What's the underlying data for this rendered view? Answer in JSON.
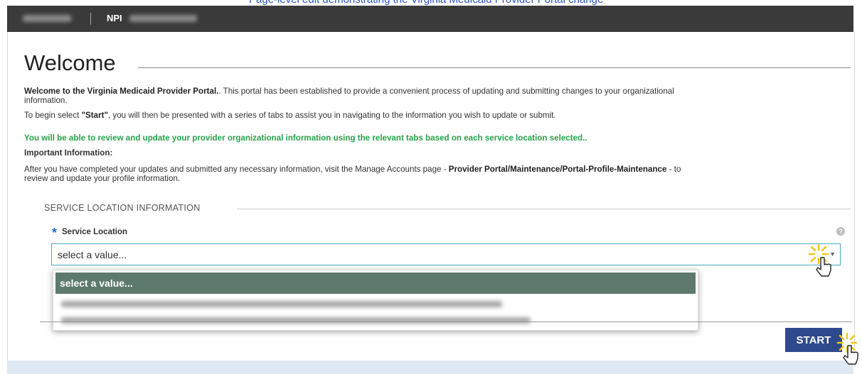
{
  "caption": "Page-level edit demonstrating the Virginia Medicaid Provider Portal change",
  "topbar": {
    "npi_label": "NPI",
    "provider_name_redacted": "Provider Name",
    "npi_number_redacted": "NPI Number"
  },
  "page": {
    "title": "Welcome"
  },
  "intro": {
    "welcome_bold": "Welcome to the Virginia Medicaid Provider Portal.",
    "welcome_rest_line1": ". This portal has been established to provide a convenient process of updating and submitting changes to your organizational",
    "welcome_rest_line2": "information.",
    "begin_prefix": "To begin select ",
    "begin_start": "\"Start\"",
    "begin_suffix": ", you will then be presented with a series of tabs to assist you in navigating to the information you wish to update or submit.",
    "green_note": "You will be able to review and update your provider organizational information using the relevant tabs based on each service location selected..",
    "important_heading": "Important Information:",
    "after_line1_prefix": "After you have completed your updates and submitted any necessary information, visit the Manage Accounts page - ",
    "after_line1_path": "Provider Portal/Maintenance/Portal-Profile-Maintenance",
    "after_line1_suffix": " - to",
    "after_line2": "review and update your profile information."
  },
  "section": {
    "legend": "SERVICE LOCATION INFORMATION",
    "required_mark": "*",
    "field_label": "Service Location",
    "help_icon_glyph": "?",
    "select_value": "select a value...",
    "chevron_glyph": "▼",
    "dropdown_options": [
      {
        "label": "select a value...",
        "selected": true
      }
    ]
  },
  "actions": {
    "start_label": "START"
  },
  "colors": {
    "topbar": "#3a3a3a",
    "green_text": "#27a24a",
    "required_star": "#1a6fc9",
    "select_border": "#4aa8c7",
    "dropdown_selected": "#5e7a6c",
    "start_button": "#2f4a8c",
    "sparkle": "#f5c518"
  },
  "icons": {
    "cursor": "pointer-cursor-icon",
    "highlight": "click-sparkle-icon",
    "help": "help-icon",
    "dropdown": "chevron-down-icon"
  }
}
